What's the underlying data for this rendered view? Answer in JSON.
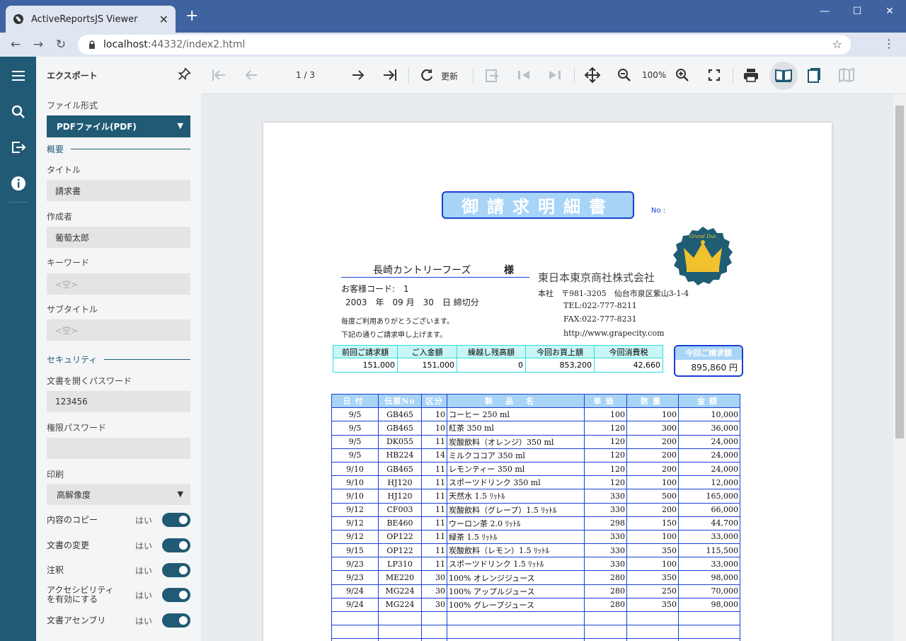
{
  "browser": {
    "tab_title": "ActiveReportsJS Viewer",
    "url_host": "localhost",
    "url_port": ":44332",
    "url_path": "/index2.html"
  },
  "panel": {
    "title": "エクスポート",
    "format_label": "ファイル形式",
    "format_value": "PDFファイル(PDF)",
    "overview": "概要",
    "title_label": "タイトル",
    "title_value": "請求書",
    "author_label": "作成者",
    "author_value": "葡萄太郎",
    "keyword_label": "キーワード",
    "keyword_placeholder": "<空>",
    "subtitle_label": "サブタイトル",
    "subtitle_placeholder": "<空>",
    "security": "セキュリティ",
    "open_pw_label": "文書を開くパスワード",
    "open_pw_value": "123456",
    "perm_pw_label": "権限パスワード",
    "perm_pw_value": "",
    "print_label": "印刷",
    "print_value": "高解像度",
    "toggles": [
      {
        "name": "内容のコピー",
        "value": "はい"
      },
      {
        "name": "文書の変更",
        "value": "はい"
      },
      {
        "name": "注釈",
        "value": "はい"
      },
      {
        "name": "アクセシビリティを有効にする",
        "value": "はい"
      },
      {
        "name": "文書アセンブリ",
        "value": "はい"
      }
    ]
  },
  "toolbar": {
    "page_indicator": "1 / 3",
    "refresh_label": "更新",
    "zoom": "100%"
  },
  "report": {
    "title": "御請求明細書",
    "no_label": "No :",
    "customer": "長崎カントリーフーズ",
    "honorific": "様",
    "customer_code": "お客様コード:　1",
    "close_date": "2003　年　09 月　30　日 締切分",
    "greeting1": "毎度ご利用ありがとうございます。",
    "greeting2": "下記の通りご請求申し上げます。",
    "company": "東日本東京商社株式会社",
    "address": "本社　〒981-3205　仙台市泉区紫山3-1-4",
    "tel": "TEL:022-777-8211",
    "fax": "FAX:022-777-8231",
    "web": "http://www.grapecity.com",
    "logo_text": "Grand Duc",
    "summary_headers": [
      "前回ご請求額",
      "ご入金額",
      "繰越し残高額",
      "今回お買上額",
      "今回消費税"
    ],
    "summary_values": [
      "151,000",
      "151,000",
      "0",
      "853,200",
      "42,660"
    ],
    "bill_label": "今回ご請求額",
    "bill_value": "895,860 円",
    "detail_headers": [
      "日付",
      "伝票No",
      "区分",
      "製品名",
      "単価",
      "数量",
      "金額"
    ],
    "rows": [
      [
        "9/5",
        "GB465",
        "10",
        "コーヒー 250 ml",
        "100",
        "100",
        "10,000"
      ],
      [
        "9/5",
        "GB465",
        "10",
        "紅茶 350 ml",
        "120",
        "300",
        "36,000"
      ],
      [
        "9/5",
        "DK055",
        "11",
        "炭酸飲料（オレンジ）350 ml",
        "120",
        "200",
        "24,000"
      ],
      [
        "9/5",
        "HB224",
        "14",
        "ミルクココア 350 ml",
        "120",
        "200",
        "24,000"
      ],
      [
        "9/10",
        "GB465",
        "11",
        "レモンティー 350 ml",
        "120",
        "200",
        "24,000"
      ],
      [
        "9/10",
        "HJ120",
        "11",
        "スポーツドリンク 350 ml",
        "120",
        "100",
        "12,000"
      ],
      [
        "9/10",
        "HJ120",
        "11",
        "天然水 1.5 ﾘｯﾄﾙ",
        "330",
        "500",
        "165,000"
      ],
      [
        "9/12",
        "CF003",
        "11",
        "炭酸飲料（グレープ）1.5 ﾘｯﾄﾙ",
        "330",
        "200",
        "66,000"
      ],
      [
        "9/12",
        "BE460",
        "11",
        "ウーロン茶 2.0 ﾘｯﾄﾙ",
        "298",
        "150",
        "44,700"
      ],
      [
        "9/12",
        "OP122",
        "11",
        "緑茶 1.5 ﾘｯﾄﾙ",
        "330",
        "100",
        "33,000"
      ],
      [
        "9/15",
        "OP122",
        "11",
        "炭酸飲料（レモン）1.5 ﾘｯﾄﾙ",
        "330",
        "350",
        "115,500"
      ],
      [
        "9/23",
        "LP310",
        "11",
        "スポーツドリンク 1.5 ﾘｯﾄﾙ",
        "330",
        "100",
        "33,000"
      ],
      [
        "9/23",
        "ME220",
        "30",
        "100% オレンジジュース",
        "280",
        "350",
        "98,000"
      ],
      [
        "9/24",
        "MG224",
        "30",
        "100% アップルジュース",
        "280",
        "250",
        "70,000"
      ],
      [
        "9/24",
        "MG224",
        "30",
        "100% グレープジュース",
        "280",
        "350",
        "98,000"
      ]
    ]
  }
}
